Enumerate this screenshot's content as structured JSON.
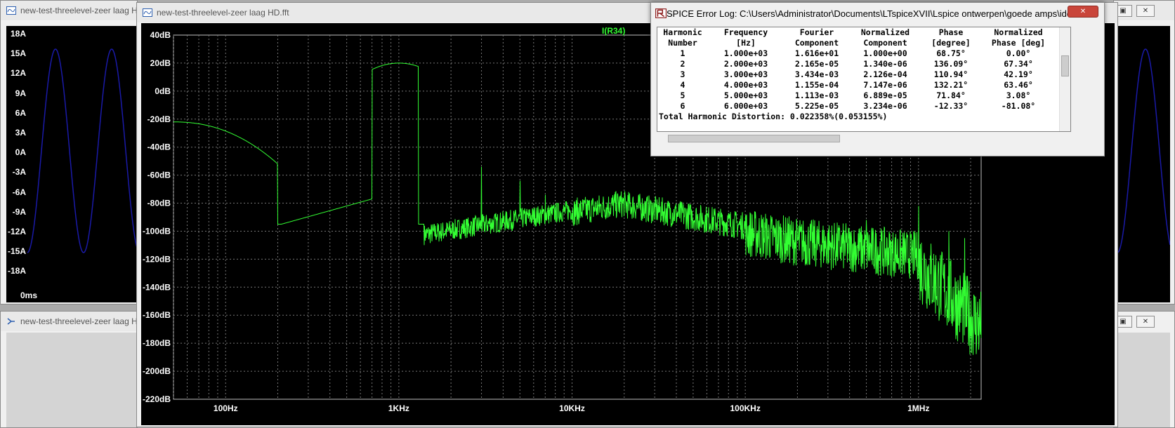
{
  "windows": {
    "left_title": "new-test-threelevel-zeer laag H",
    "bottom_title": "new-test-threelevel-zeer laag H",
    "fft_title": "new-test-threelevel-zeer laag HD.fft"
  },
  "left_plot": {
    "y_ticks": [
      "18A",
      "15A",
      "12A",
      "9A",
      "6A",
      "3A",
      "0A",
      "-3A",
      "-6A",
      "-9A",
      "-12A",
      "-15A",
      "-18A"
    ],
    "x_label": "0ms",
    "trace_color": "#1a1aa8"
  },
  "fft_plot": {
    "trace_label": "I(R34)",
    "trace_color": "#33ff33",
    "y_ticks": [
      "40dB",
      "20dB",
      "0dB",
      "-20dB",
      "-40dB",
      "-60dB",
      "-80dB",
      "-100dB",
      "-120dB",
      "-140dB",
      "-160dB",
      "-180dB",
      "-200dB",
      "-220dB"
    ],
    "x_ticks": [
      "100Hz",
      "1KHz",
      "10KHz",
      "100KHz",
      "1MHz"
    ]
  },
  "error_log": {
    "title": "SPICE Error Log: C:\\Users\\Administrator\\Documents\\LTspiceXVII\\Lspice ontwerpen\\goede amps\\ideal mo...",
    "header1": [
      "Harmonic",
      "Frequency",
      "Fourier",
      "Normalized",
      "Phase",
      "Normalized"
    ],
    "header2": [
      "Number",
      "[Hz]",
      "Component",
      "Component",
      "[degree]",
      "Phase [deg]"
    ],
    "rows": [
      [
        "1",
        "1.000e+03",
        "1.616e+01",
        "1.000e+00",
        "68.75°",
        "0.00°"
      ],
      [
        "2",
        "2.000e+03",
        "2.165e-05",
        "1.340e-06",
        "136.09°",
        "67.34°"
      ],
      [
        "3",
        "3.000e+03",
        "3.434e-03",
        "2.126e-04",
        "110.94°",
        "42.19°"
      ],
      [
        "4",
        "4.000e+03",
        "1.155e-04",
        "7.147e-06",
        "132.21°",
        "63.46°"
      ],
      [
        "5",
        "5.000e+03",
        "1.113e-03",
        "6.889e-05",
        "71.84°",
        "3.08°"
      ],
      [
        "6",
        "6.000e+03",
        "5.225e-05",
        "3.234e-06",
        "-12.33°",
        "-81.08°"
      ]
    ],
    "thd": "Total Harmonic Distortion: 0.022358%(0.053155%)"
  },
  "icons": {
    "waveform": "waveform-icon",
    "schematic": "schematic-icon",
    "log": "error-log-icon"
  }
}
